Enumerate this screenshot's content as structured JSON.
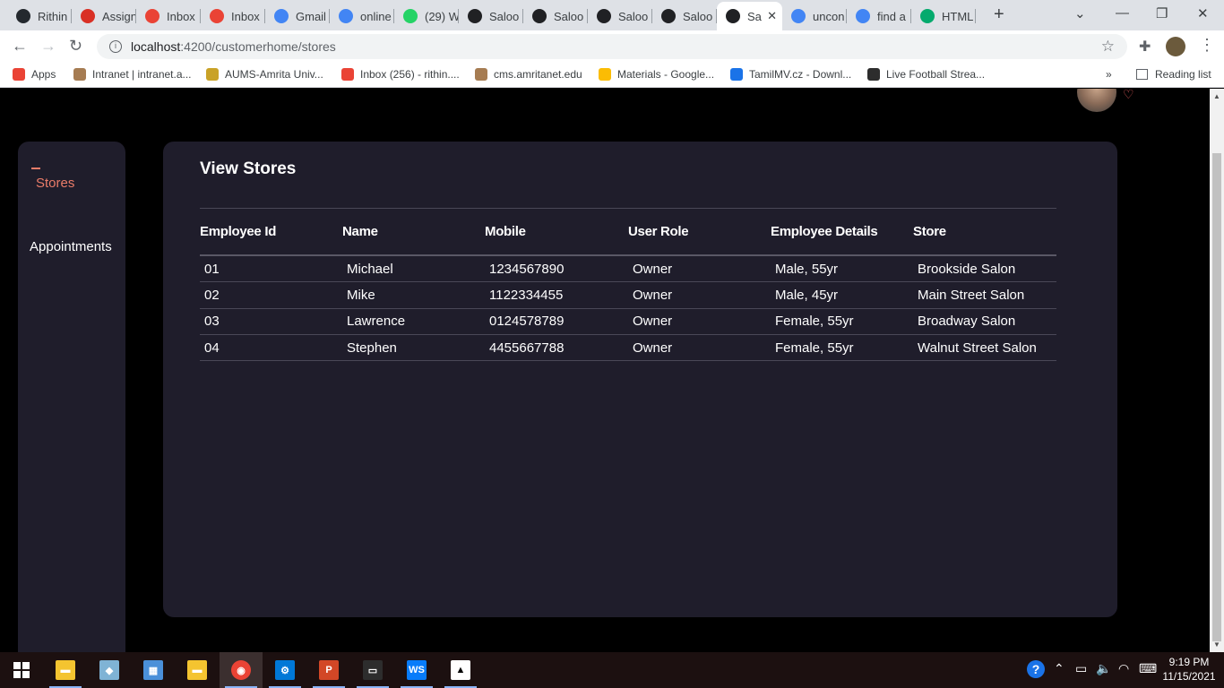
{
  "browser": {
    "tabs": [
      {
        "label": "Rithin",
        "icon": "github-icon",
        "color": "#24292e"
      },
      {
        "label": "Assign",
        "icon": "amrita-icon",
        "color": "#d93025"
      },
      {
        "label": "Inbox",
        "icon": "gmail-icon",
        "color": "#ea4335"
      },
      {
        "label": "Inbox",
        "icon": "gmail-icon",
        "color": "#ea4335"
      },
      {
        "label": "Gmail",
        "icon": "google-icon",
        "color": "#4285f4"
      },
      {
        "label": "online",
        "icon": "google-icon",
        "color": "#4285f4"
      },
      {
        "label": "(29) W",
        "icon": "whatsapp-icon",
        "color": "#25d366"
      },
      {
        "label": "Saloo",
        "icon": "angular-icon",
        "color": "#202124"
      },
      {
        "label": "Saloo",
        "icon": "angular-icon",
        "color": "#202124"
      },
      {
        "label": "Saloo",
        "icon": "angular-icon",
        "color": "#202124"
      },
      {
        "label": "Saloo",
        "icon": "angular-icon",
        "color": "#202124"
      },
      {
        "label": "Sa",
        "icon": "angular-icon",
        "color": "#202124",
        "active": true
      },
      {
        "label": "uncon",
        "icon": "google-icon",
        "color": "#4285f4"
      },
      {
        "label": "find a",
        "icon": "google-icon",
        "color": "#4285f4"
      },
      {
        "label": "HTML",
        "icon": "w3-icon",
        "color": "#04aa6d"
      }
    ],
    "url_host": "localhost",
    "url_path": ":4200/customerhome/stores",
    "bookmarks": [
      {
        "label": "Apps",
        "color": "#ea4335"
      },
      {
        "label": "Intranet | intranet.a...",
        "color": "#a67c52"
      },
      {
        "label": "AUMS-Amrita Univ...",
        "color": "#c9a227"
      },
      {
        "label": "Inbox (256) - rithin....",
        "color": "#ea4335"
      },
      {
        "label": "cms.amritanet.edu",
        "color": "#a67c52"
      },
      {
        "label": "Materials - Google...",
        "color": "#fbbc04"
      },
      {
        "label": "TamilMV.cz - Downl...",
        "color": "#1a73e8"
      },
      {
        "label": "Live Football Strea...",
        "color": "#2d2d2d"
      }
    ],
    "more_bookmarks": "»",
    "reading_list": "Reading list"
  },
  "sidebar": {
    "items": [
      {
        "label": "Stores",
        "active": true
      },
      {
        "label": "Appointments",
        "active": false
      }
    ]
  },
  "main": {
    "title": "View Stores",
    "columns": [
      "Employee Id",
      "Name",
      "Mobile",
      "User Role",
      "Employee Details",
      "Store"
    ],
    "rows": [
      [
        "01",
        "Michael",
        "1234567890",
        "Owner",
        "Male, 55yr",
        "Brookside Salon"
      ],
      [
        "02",
        "Mike",
        "1122334455",
        "Owner",
        "Male, 45yr",
        "Main Street Salon"
      ],
      [
        "03",
        "Lawrence",
        "0124578789",
        "Owner",
        "Female, 55yr",
        "Broadway Salon"
      ],
      [
        "04",
        "Stephen",
        "4455667788",
        "Owner",
        "Female, 55yr",
        "Walnut Street Salon"
      ]
    ]
  },
  "taskbar": {
    "apps": [
      {
        "name": "file-explorer",
        "color": "#f4c430"
      },
      {
        "name": "notepad-app",
        "color": "#7fb3d5"
      },
      {
        "name": "control-panel",
        "color": "#4a90d9"
      },
      {
        "name": "folder-app",
        "color": "#f4c430"
      },
      {
        "name": "chrome-app",
        "color": "#ea4335",
        "active": true
      },
      {
        "name": "settings-app",
        "color": "#0078d7"
      },
      {
        "name": "powerpoint-app",
        "color": "#d24726"
      },
      {
        "name": "terminal-app",
        "color": "#2d2d2d"
      },
      {
        "name": "webstorm-app",
        "color": "#087cfa"
      },
      {
        "name": "photos-app",
        "color": "#ffffff"
      }
    ],
    "time": "9:19 PM",
    "date": "11/15/2021"
  }
}
